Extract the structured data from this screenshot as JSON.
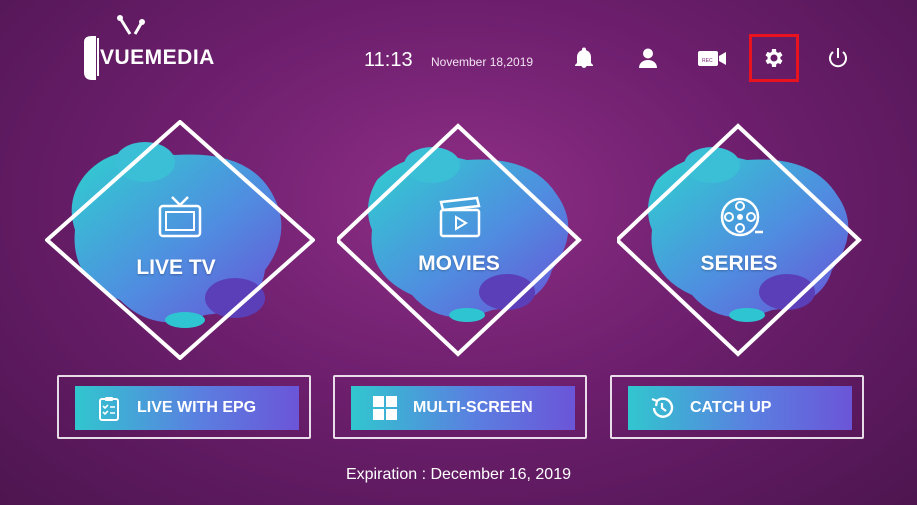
{
  "header": {
    "logo_text": "VUEMEDIA",
    "time": "11:13",
    "date": "November 18,2019",
    "icons": [
      "bell-icon",
      "user-icon",
      "record-icon",
      "gear-icon",
      "power-icon"
    ],
    "selected_icon": "gear-icon",
    "selection_color": "#e8131f"
  },
  "tiles": [
    {
      "label": "LIVE TV",
      "icon": "tv-icon"
    },
    {
      "label": "MOVIES",
      "icon": "clapperboard-icon"
    },
    {
      "label": "SERIES",
      "icon": "film-reel-icon"
    }
  ],
  "buttons": [
    {
      "label": "LIVE WITH EPG",
      "icon": "checklist-icon"
    },
    {
      "label": "MULTI-SCREEN",
      "icon": "grid-icon"
    },
    {
      "label": "CATCH UP",
      "icon": "history-icon"
    }
  ],
  "footer": {
    "expiration": "Expiration : December 16, 2019"
  },
  "colors": {
    "background": "#7a2276",
    "accent_cyan": "#31c6cf",
    "accent_violet": "#6b55d8"
  }
}
